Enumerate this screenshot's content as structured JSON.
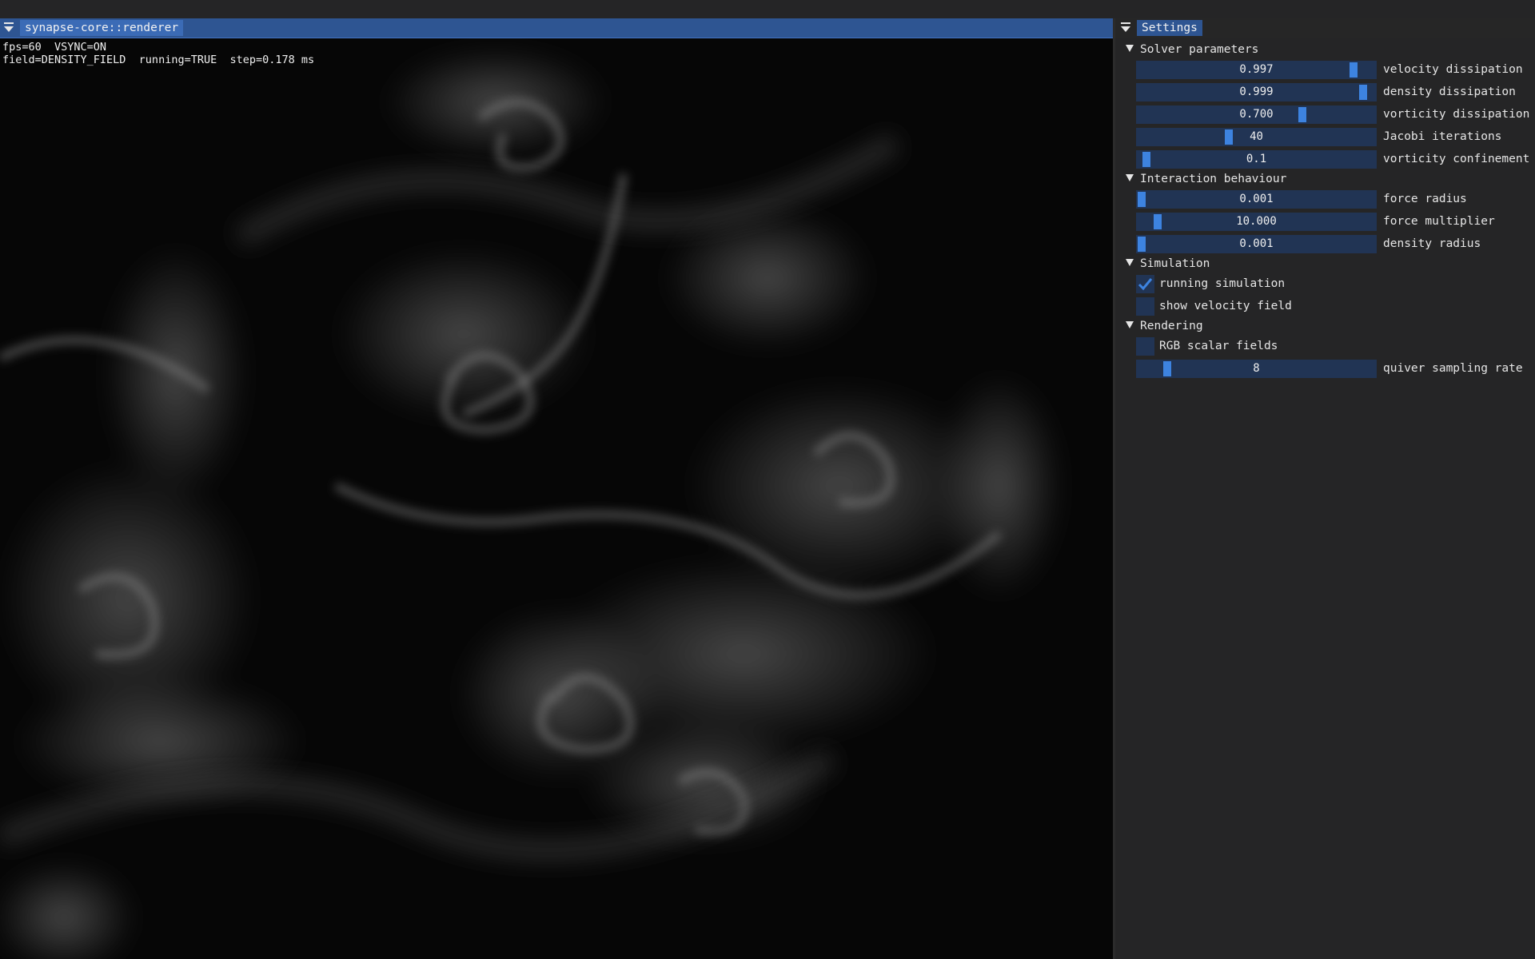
{
  "renderer": {
    "title": "synapse-core::renderer",
    "stats_line1": "fps=60  VSYNC=ON",
    "stats_line2": "field=DENSITY_FIELD  running=TRUE  step=0.178 ms"
  },
  "settings": {
    "title": "Settings",
    "sections": {
      "solver": {
        "label": "Solver parameters",
        "velocity_dissipation": {
          "value": "0.997",
          "label": "velocity dissipation",
          "level": 0.925
        },
        "density_dissipation": {
          "value": "0.999",
          "label": "density dissipation",
          "level": 0.965
        },
        "vorticity_dissipation": {
          "value": "0.700",
          "label": "vorticity dissipation",
          "level": 0.7
        },
        "jacobi_iterations": {
          "value": "40",
          "label": "Jacobi iterations",
          "level": 0.38
        },
        "vorticity_confinement": {
          "value": "0.1",
          "label": "vorticity confinement",
          "level": 0.02
        }
      },
      "interaction": {
        "label": "Interaction behaviour",
        "force_radius": {
          "value": "0.001",
          "label": "force radius",
          "level": 0.0
        },
        "force_multiplier": {
          "value": "10.000",
          "label": "force multiplier",
          "level": 0.07
        },
        "density_radius": {
          "value": "0.001",
          "label": "density radius",
          "level": 0.0
        }
      },
      "simulation": {
        "label": "Simulation",
        "running_simulation": {
          "label": "running simulation",
          "checked": true
        },
        "show_velocity_field": {
          "label": "show velocity field",
          "checked": false
        }
      },
      "rendering": {
        "label": "Rendering",
        "rgb_scalar_fields": {
          "label": "RGB scalar fields",
          "checked": false
        },
        "quiver_sampling_rate": {
          "value": "8",
          "label": "quiver sampling rate",
          "level": 0.11
        }
      }
    }
  },
  "colors": {
    "title_bar_active": "#2e5592",
    "slider_frame": "#213454",
    "slider_grab": "#3d83e0",
    "check_mark": "#3d83e0"
  },
  "icons": {
    "window_collapse": "collapse-menu-icon",
    "section_open": "triangle-down-icon",
    "check": "checkmark-icon"
  }
}
